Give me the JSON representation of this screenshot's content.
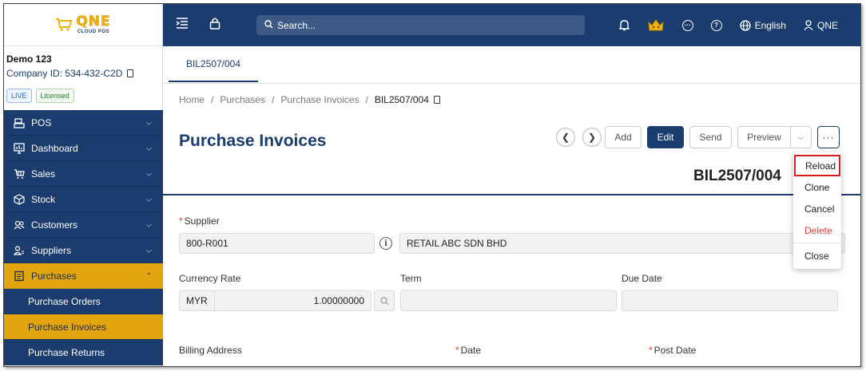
{
  "logo": {
    "brand": "QNE",
    "sub": "CLOUD POS"
  },
  "company": {
    "name": "Demo 123",
    "id": "Company ID: 534-432-C2D",
    "badge_live": "LIVE",
    "badge_licensed": "Licensed"
  },
  "sidebar": {
    "items": [
      {
        "label": "POS",
        "icon": "pos-icon"
      },
      {
        "label": "Dashboard",
        "icon": "dashboard-icon"
      },
      {
        "label": "Sales",
        "icon": "sales-icon"
      },
      {
        "label": "Stock",
        "icon": "stock-icon"
      },
      {
        "label": "Customers",
        "icon": "customers-icon"
      },
      {
        "label": "Suppliers",
        "icon": "suppliers-icon"
      },
      {
        "label": "Purchases",
        "icon": "purchases-icon"
      }
    ],
    "subitems": [
      {
        "label": "Purchase Orders"
      },
      {
        "label": "Purchase Invoices"
      },
      {
        "label": "Purchase Returns"
      }
    ]
  },
  "topbar": {
    "search_placeholder": "Search...",
    "language": "English",
    "user": "QNE"
  },
  "tab": {
    "label": "BIL2507/004"
  },
  "breadcrumb": {
    "home": "Home",
    "purchases": "Purchases",
    "purchase_invoices": "Purchase Invoices",
    "current": "BIL2507/004"
  },
  "page": {
    "title": "Purchase Invoices",
    "doc_no": "BIL2507/004"
  },
  "toolbar": {
    "add": "Add",
    "edit": "Edit",
    "send": "Send",
    "preview": "Preview",
    "more": "···"
  },
  "dropdown": {
    "reload": "Reload",
    "clone": "Clone",
    "cancel": "Cancel",
    "delete": "Delete",
    "close": "Close"
  },
  "form": {
    "supplier_label": "Supplier",
    "supplier_code": "800-R001",
    "supplier_name": "RETAIL ABC SDN BHD",
    "currency_rate_label": "Currency Rate",
    "currency": "MYR",
    "rate": "1.00000000",
    "term_label": "Term",
    "term_value": "",
    "due_date_label": "Due Date",
    "due_date_value": "",
    "billing_address_label": "Billing Address",
    "date_label": "Date",
    "post_date_label": "Post Date"
  },
  "colors": {
    "primary": "#1b3c6f",
    "accent": "#e3a50e",
    "danger": "#e03e3e"
  }
}
